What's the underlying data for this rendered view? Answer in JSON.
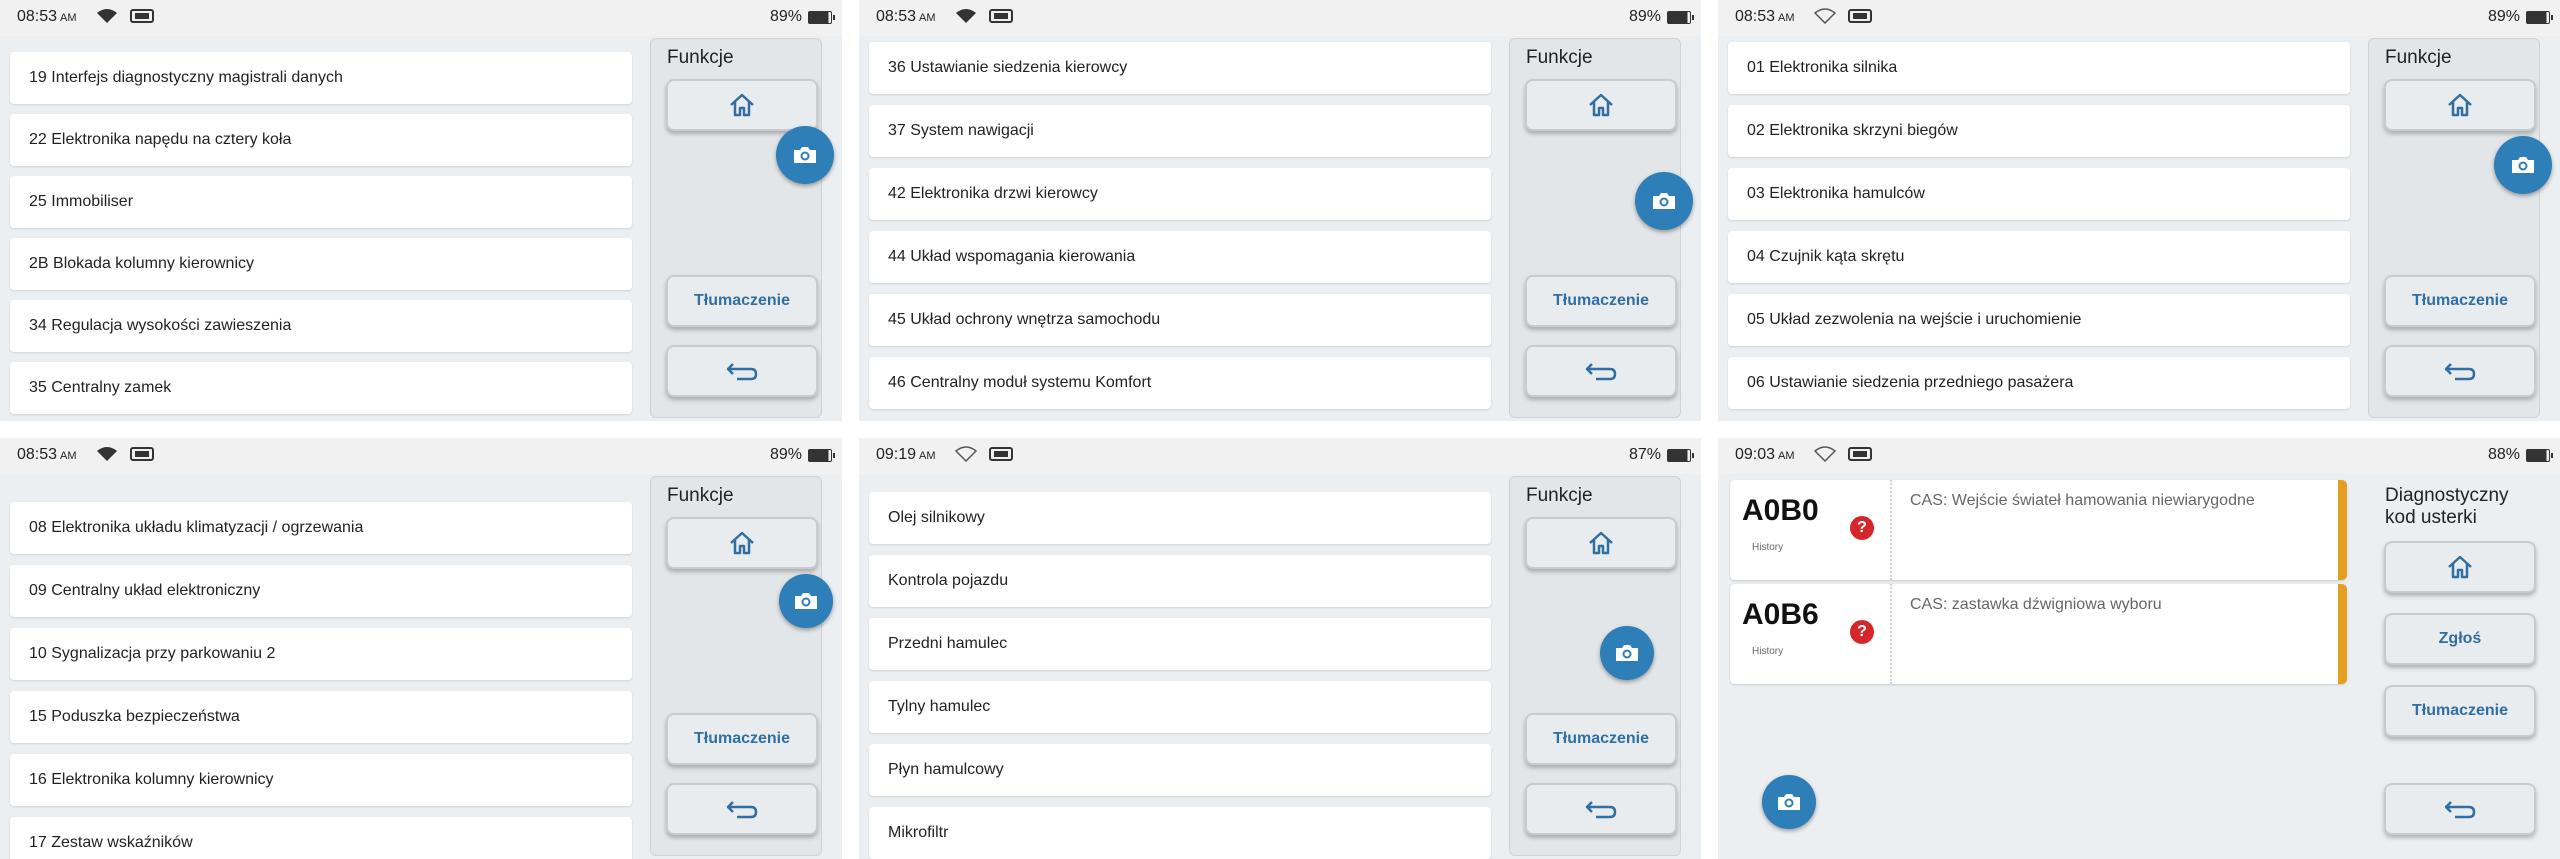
{
  "status": {
    "p1": {
      "time": "08:53",
      "ampm": "AM",
      "battery": "89%"
    },
    "p2": {
      "time": "08:53",
      "ampm": "AM",
      "battery": "89%"
    },
    "p3": {
      "time": "08:53",
      "ampm": "AM",
      "battery": "89%"
    },
    "p4": {
      "time": "08:53",
      "ampm": "AM",
      "battery": "89%"
    },
    "p5": {
      "time": "09:19",
      "ampm": "AM",
      "battery": "87%"
    },
    "p6": {
      "time": "09:03",
      "ampm": "AM",
      "battery": "88%"
    }
  },
  "side": {
    "title": "Funkcje",
    "translate": "Tłumaczenie",
    "p6_title": "Diagnostyczny kod usterki",
    "p6_report": "Zgłoś"
  },
  "lists": {
    "p1": [
      "19 Interfejs diagnostyczny magistrali danych",
      "22 Elektronika napędu na cztery koła",
      "25 Immobiliser",
      "2B Blokada kolumny kierownicy",
      "34 Regulacja wysokości zawieszenia",
      "35 Centralny zamek"
    ],
    "p2": [
      "36 Ustawianie siedzenia kierowcy",
      "37 System nawigacji",
      "42 Elektronika drzwi kierowcy",
      "44 Układ wspomagania kierowania",
      "45 Układ ochrony wnętrza samochodu",
      "46 Centralny moduł systemu Komfort"
    ],
    "p3": [
      "01 Elektronika silnika",
      "02 Elektronika skrzyni biegów",
      "03 Elektronika hamulców",
      "04 Czujnik kąta skrętu",
      "05 Układ zezwolenia na wejście i uruchomienie",
      "06 Ustawianie siedzenia przedniego pasażera"
    ],
    "p4": [
      "08 Elektronika układu klimatyzacji / ogrzewania",
      "09 Centralny układ elektroniczny",
      "10 Sygnalizacja przy parkowaniu 2",
      "15 Poduszka bezpieczeństwa",
      "16 Elektronika kolumny kierownicy",
      "17 Zestaw wskaźników"
    ],
    "p5": [
      "Olej silnikowy",
      "Kontrola pojazdu",
      "Przedni hamulec",
      "Tylny hamulec",
      "Płyn hamulcowy",
      "Mikrofiltr"
    ]
  },
  "dtc": [
    {
      "code": "A0B0",
      "history": "History",
      "desc": "CAS: Wejście świateł hamowania niewiarygodne"
    },
    {
      "code": "A0B6",
      "history": "History",
      "desc": "CAS: zastawka dźwigniowa wyboru"
    }
  ],
  "icons": {
    "home": "home-icon",
    "back": "back-arrow-icon",
    "camera": "camera-icon",
    "help": "question-icon",
    "wifi": "wifi-icon",
    "battery": "battery-icon",
    "device": "vci-device-icon"
  },
  "colors": {
    "accent": "#2e7fb8",
    "button_text": "#2f6fa3",
    "help": "#d5262b",
    "dtc_bar": "#e3a020"
  }
}
